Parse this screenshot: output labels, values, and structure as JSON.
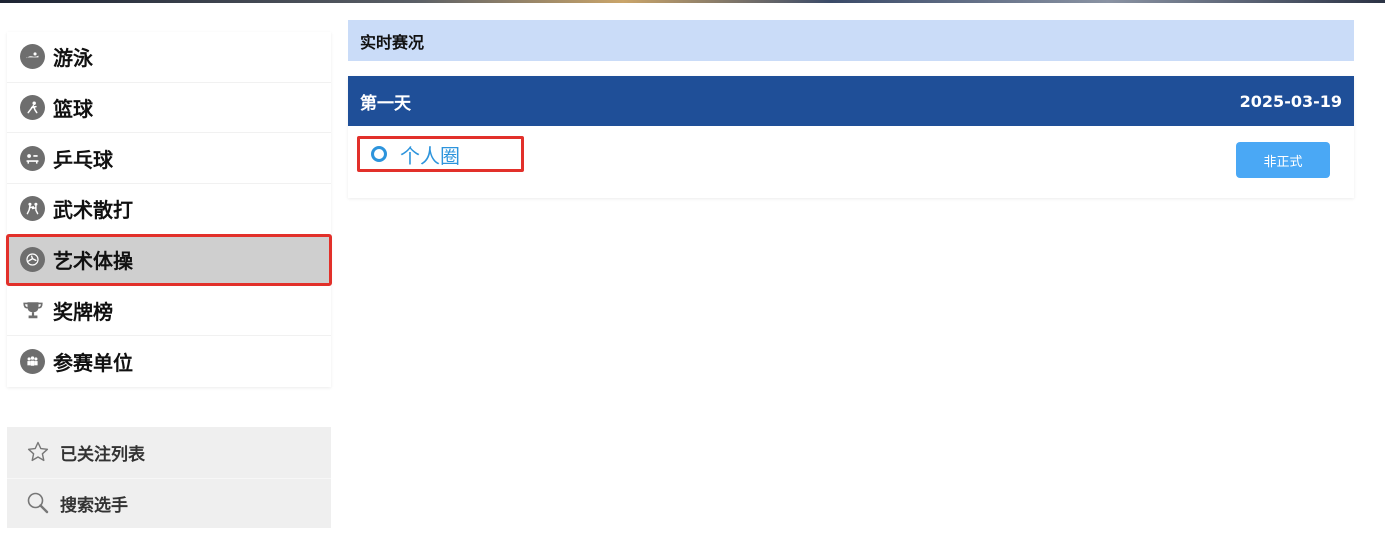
{
  "sidebar": {
    "items": [
      {
        "label": "游泳",
        "icon": "swimming-icon"
      },
      {
        "label": "篮球",
        "icon": "basketball-icon"
      },
      {
        "label": "乒乓球",
        "icon": "table-tennis-icon"
      },
      {
        "label": "武术散打",
        "icon": "martial-arts-icon"
      },
      {
        "label": "艺术体操",
        "icon": "rhythmic-gymnastics-icon",
        "active": true
      },
      {
        "label": "奖牌榜",
        "icon": "trophy-icon"
      },
      {
        "label": "参赛单位",
        "icon": "team-icon"
      }
    ],
    "tools": [
      {
        "label": "已关注列表",
        "icon": "star-icon"
      },
      {
        "label": "搜索选手",
        "icon": "search-icon"
      }
    ]
  },
  "main": {
    "section_title": "实时赛况",
    "day": {
      "title": "第一天",
      "date": "2025-03-19",
      "events": [
        {
          "name": "个人圈",
          "status": "非正式"
        }
      ]
    }
  },
  "colors": {
    "header_blue": "#1f4f98",
    "section_bg": "#cadcf8",
    "link_blue": "#2d94dc",
    "button_blue": "#4aa8f5",
    "highlight_red": "#e2302a",
    "active_bg": "#cfcfcf"
  }
}
